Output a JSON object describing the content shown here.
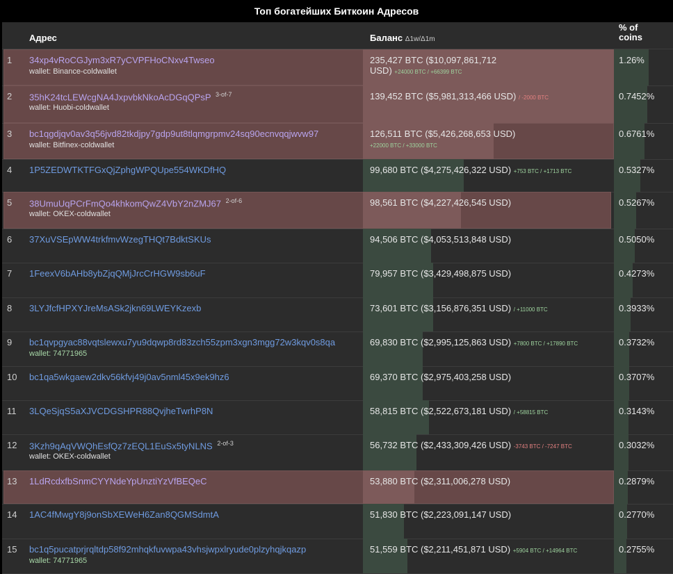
{
  "title": "Топ  богатейших Биткоин Адресов",
  "header": {
    "address": "Адрес",
    "balance": "Баланс",
    "balance_sub": "Δ1w/Δ1m",
    "percent_line1": "% of",
    "percent_line2": "coins"
  },
  "rows": [
    {
      "rank": "1",
      "address": "34xp4vRoCGJym3xR7yCVPFHoCNxv4Twseo",
      "sig": "",
      "wallet": "wallet: Binance-coldwallet",
      "balance": "235,427 BTC ($10,097,861,712 USD)",
      "delta": "+24000 BTC / +66399 BTC",
      "delta_sign": "pos",
      "percent": "1.26%"
    },
    {
      "rank": "2",
      "address": "35hK24tcLEWcgNA4JxpvbkNkoAcDGqQPsP",
      "sig": "3-of-7",
      "wallet": "wallet: Huobi-coldwallet",
      "balance": "139,452 BTC ($5,981,313,466 USD)",
      "delta": "/ -2000 BTC",
      "delta_sign": "neg",
      "percent": "0.7452%"
    },
    {
      "rank": "3",
      "address": "bc1qgdjqv0av3q56jvd82tkdjpy7gdp9ut8tlqmgrpmv24sq90ecnvqqjwvw97",
      "sig": "",
      "wallet": "wallet: Bitfinex-coldwallet",
      "balance": "126,511 BTC ($5,426,268,653 USD)",
      "delta": "+22000 BTC / +33000 BTC",
      "delta_sign": "pos",
      "percent": "0.6761%"
    },
    {
      "rank": "4",
      "address": "1P5ZEDWTKTFGxQjZphgWPQUpe554WKDfHQ",
      "sig": "",
      "wallet": "",
      "balance": "99,680 BTC ($4,275,426,322 USD)",
      "delta": "+753 BTC / +1713 BTC",
      "delta_sign": "pos",
      "percent": "0.5327%"
    },
    {
      "rank": "5",
      "address": "38UmuUqPCrFmQo4khkomQwZ4VbY2nZMJ67",
      "sig": "2-of-6",
      "wallet": "wallet: OKEX-coldwallet",
      "balance": "98,561 BTC ($4,227,426,545 USD)",
      "delta": "",
      "delta_sign": "pos",
      "percent": "0.5267%"
    },
    {
      "rank": "6",
      "address": "37XuVSEpWW4trkfmvWzegTHQt7BdktSKUs",
      "sig": "",
      "wallet": "",
      "balance": "94,506 BTC ($4,053,513,848 USD)",
      "delta": "",
      "delta_sign": "pos",
      "percent": "0.5050%"
    },
    {
      "rank": "7",
      "address": "1FeexV6bAHb8ybZjqQMjJrcCrHGW9sb6uF",
      "sig": "",
      "wallet": "",
      "balance": "79,957 BTC ($3,429,498,875 USD)",
      "delta": "",
      "delta_sign": "pos",
      "percent": "0.4273%"
    },
    {
      "rank": "8",
      "address": "3LYJfcfHPXYJreMsASk2jkn69LWEYKzexb",
      "sig": "",
      "wallet": "",
      "balance": "73,601 BTC ($3,156,876,351 USD)",
      "delta": "/ +11000 BTC",
      "delta_sign": "pos",
      "percent": "0.3933%"
    },
    {
      "rank": "9",
      "address": "bc1qvpgyac88vqtslewxu7yu9dqwp8rd83zch55zpm3xgn3mgg72w3kqv0s8qa",
      "sig": "",
      "wallet": "wallet: 74771965",
      "balance": "69,830 BTC ($2,995,125,863 USD)",
      "delta": "+7800 BTC / +17890 BTC",
      "delta_sign": "pos",
      "percent": "0.3732%"
    },
    {
      "rank": "10",
      "address": "bc1qa5wkgaew2dkv56kfvj49j0av5nml45x9ek9hz6",
      "sig": "",
      "wallet": "",
      "balance": "69,370 BTC ($2,975,403,258 USD)",
      "delta": "",
      "delta_sign": "pos",
      "percent": "0.3707%"
    },
    {
      "rank": "11",
      "address": "3LQeSjqS5aXJVCDGSHPR88QvjheTwrhP8N",
      "sig": "",
      "wallet": "",
      "balance": "58,815 BTC ($2,522,673,181 USD)",
      "delta": "/ +58815 BTC",
      "delta_sign": "pos",
      "percent": "0.3143%"
    },
    {
      "rank": "12",
      "address": "3Kzh9qAqVWQhEsfQz7zEQL1EuSx5tyNLNS",
      "sig": "2-of-3",
      "wallet": "wallet: OKEX-coldwallet",
      "balance": "56,732 BTC ($2,433,309,426 USD)",
      "delta": "-3743 BTC / -7247 BTC",
      "delta_sign": "neg",
      "percent": "0.3032%"
    },
    {
      "rank": "13",
      "address": "1LdRcdxfbSnmCYYNdeYpUnztiYzVfBEQeC",
      "sig": "",
      "wallet": "",
      "balance": "53,880 BTC ($2,311,006,278 USD)",
      "delta": "",
      "delta_sign": "pos",
      "percent": "0.2879%"
    },
    {
      "rank": "14",
      "address": "1AC4fMwgY8j9onSbXEWeH6Zan8QGMSdmtA",
      "sig": "",
      "wallet": "",
      "balance": "51,830 BTC ($2,223,091,147 USD)",
      "delta": "",
      "delta_sign": "pos",
      "percent": "0.2770%"
    },
    {
      "rank": "15",
      "address": "bc1q5pucatprjrqltdp58f92mhqkfuvwpa43vhsjwpxlryude0plzyhqjkqazp",
      "sig": "",
      "wallet": "wallet: 74771965",
      "balance": "51,559 BTC ($2,211,451,871 USD)",
      "delta": "+5904 BTC / +14964 BTC",
      "delta_sign": "pos",
      "percent": "0.2755%"
    }
  ]
}
